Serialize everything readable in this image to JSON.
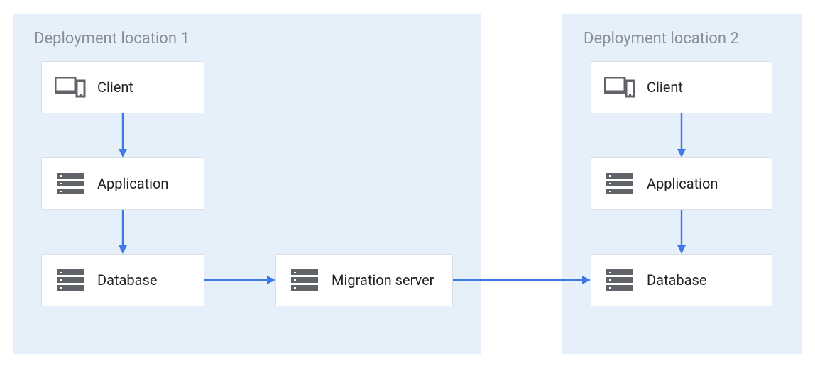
{
  "regions": {
    "loc1": {
      "title": "Deployment location 1"
    },
    "loc2": {
      "title": "Deployment location 2"
    }
  },
  "nodes": {
    "client1": "Client",
    "app1": "Application",
    "db1": "Database",
    "migration": "Migration server",
    "client2": "Client",
    "app2": "Application",
    "db2": "Database"
  },
  "edges": [
    {
      "from": "client1",
      "to": "app1"
    },
    {
      "from": "app1",
      "to": "db1"
    },
    {
      "from": "db1",
      "to": "migration"
    },
    {
      "from": "migration",
      "to": "db2"
    },
    {
      "from": "client2",
      "to": "app2"
    },
    {
      "from": "app2",
      "to": "db2"
    }
  ],
  "colors": {
    "region_bg": "#e5f0fb",
    "node_bg": "#ffffff",
    "node_border": "#dcdfe3",
    "arrow": "#3f79e6",
    "title": "#8a8f96",
    "icon": "#606367"
  }
}
